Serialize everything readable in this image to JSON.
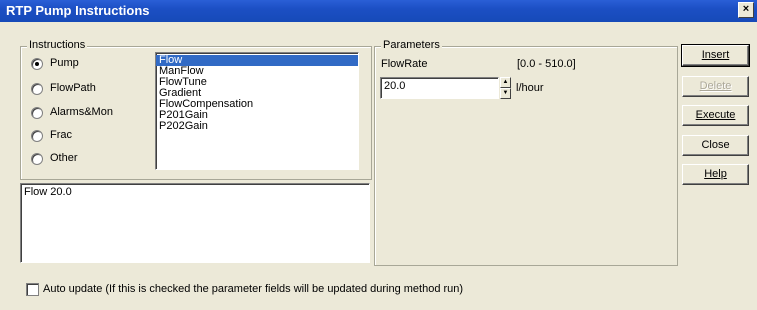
{
  "window": {
    "title": "RTP Pump Instructions",
    "close_glyph": "×"
  },
  "instructions": {
    "legend": "Instructions",
    "radios": [
      {
        "label": "Pump",
        "checked": true
      },
      {
        "label": "FlowPath",
        "checked": false
      },
      {
        "label": "Alarms&Mon",
        "checked": false
      },
      {
        "label": "Frac",
        "checked": false
      },
      {
        "label": "Other",
        "checked": false
      }
    ],
    "list_items": [
      "Flow",
      "ManFlow",
      "FlowTune",
      "Gradient",
      "FlowCompensation",
      "P201Gain",
      "P202Gain"
    ],
    "selected_item": "Flow",
    "preview_text": "Flow 20.0"
  },
  "parameters": {
    "legend": "Parameters",
    "name": "FlowRate",
    "range": "[0.0 - 510.0]",
    "value": "20.0",
    "unit": "l/hour"
  },
  "buttons": {
    "insert": "Insert",
    "delete": "Delete",
    "execute": "Execute",
    "close": "Close",
    "help": "Help"
  },
  "auto_update": {
    "label": "Auto update (If this is checked the parameter fields will be updated during method run)",
    "checked": false
  },
  "colors": {
    "title_bar": "#1c4fc4",
    "selection": "#316ac5",
    "dialog_bg": "#ece9d8"
  }
}
